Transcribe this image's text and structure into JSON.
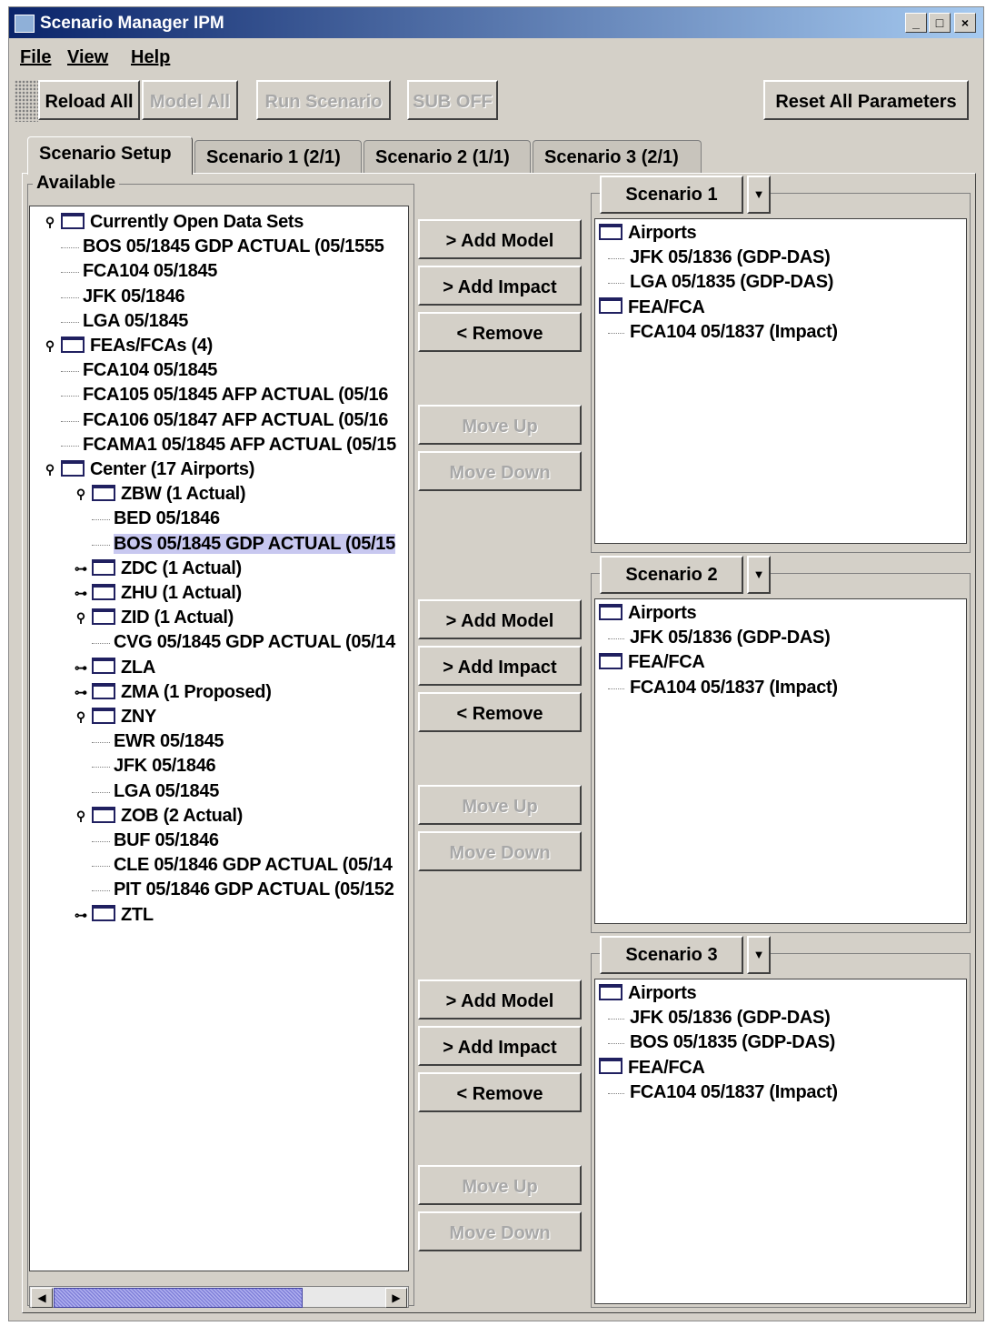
{
  "window": {
    "title": "Scenario Manager IPM",
    "minimize": "_",
    "maximize": "□",
    "close": "×"
  },
  "menu": [
    {
      "label": "File"
    },
    {
      "label": "View"
    },
    {
      "label": "Help"
    }
  ],
  "toolbar": {
    "reload_all": "Reload All",
    "model_all": "Model All",
    "run_scenario": "Run Scenario",
    "sub_off": "SUB OFF",
    "reset_all": "Reset All Parameters"
  },
  "tabs": [
    {
      "label": "Scenario Setup"
    },
    {
      "label": "Scenario 1 (2/1)"
    },
    {
      "label": "Scenario 2 (1/1)"
    },
    {
      "label": "Scenario 3 (2/1)"
    }
  ],
  "available": {
    "label": "Available",
    "rows": [
      "Currently Open Data Sets",
      "BOS 05/1845 GDP ACTUAL (05/1555",
      "FCA104 05/1845",
      "JFK 05/1846",
      "LGA 05/1845",
      "FEAs/FCAs (4)",
      "FCA104 05/1845",
      "FCA105 05/1845 AFP ACTUAL (05/16",
      "FCA106 05/1847 AFP ACTUAL (05/16",
      "FCAMA1 05/1845 AFP ACTUAL (05/15",
      "Center (17 Airports)",
      "ZBW (1 Actual)",
      "BED 05/1846",
      "BOS 05/1845 GDP ACTUAL (05/15",
      "ZDC (1 Actual)",
      "ZHU (1 Actual)",
      "ZID (1 Actual)",
      "CVG 05/1845 GDP ACTUAL (05/14",
      "ZLA",
      "ZMA (1 Proposed)",
      "ZNY",
      "EWR 05/1845",
      "JFK 05/1846",
      "LGA 05/1845",
      "ZOB (2 Actual)",
      "BUF 05/1846",
      "CLE 05/1846 GDP ACTUAL (05/14",
      "PIT 05/1846 GDP ACTUAL (05/152",
      "ZTL"
    ]
  },
  "actions": {
    "add_model": "> Add Model",
    "add_impact": "> Add Impact",
    "remove": "< Remove",
    "move_up": "Move Up",
    "move_down": "Move Down"
  },
  "scenarios": [
    {
      "name": "Scenario 1",
      "rows": [
        "Airports",
        "JFK 05/1836 (GDP-DAS)",
        "LGA 05/1835 (GDP-DAS)",
        "FEA/FCA",
        "FCA104 05/1837 (Impact)"
      ]
    },
    {
      "name": "Scenario 2",
      "rows": [
        "Airports",
        "JFK 05/1836 (GDP-DAS)",
        "FEA/FCA",
        "FCA104 05/1837 (Impact)"
      ]
    },
    {
      "name": "Scenario 3",
      "rows": [
        "Airports",
        "JFK 05/1836 (GDP-DAS)",
        "BOS 05/1835 (GDP-DAS)",
        "FEA/FCA",
        "FCA104 05/1837 (Impact)"
      ]
    }
  ]
}
